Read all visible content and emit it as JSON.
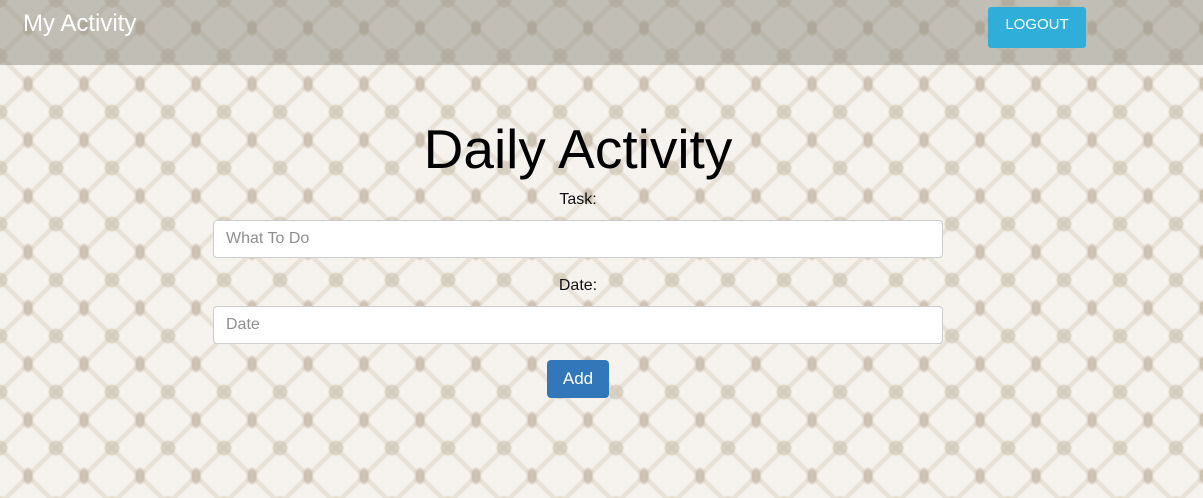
{
  "navbar": {
    "brand": "My Activity",
    "logout_label": "LOGOUT"
  },
  "main": {
    "title": "Daily Activity",
    "task_label": "Task:",
    "task_placeholder": "What To Do",
    "task_value": "",
    "date_label": "Date:",
    "date_placeholder": "Date",
    "date_value": "",
    "add_label": "Add"
  },
  "colors": {
    "navbar_bg": "#96918799",
    "logout_button": "#2eaed8",
    "add_button": "#3377bb",
    "page_background": "#f6f3ee"
  }
}
